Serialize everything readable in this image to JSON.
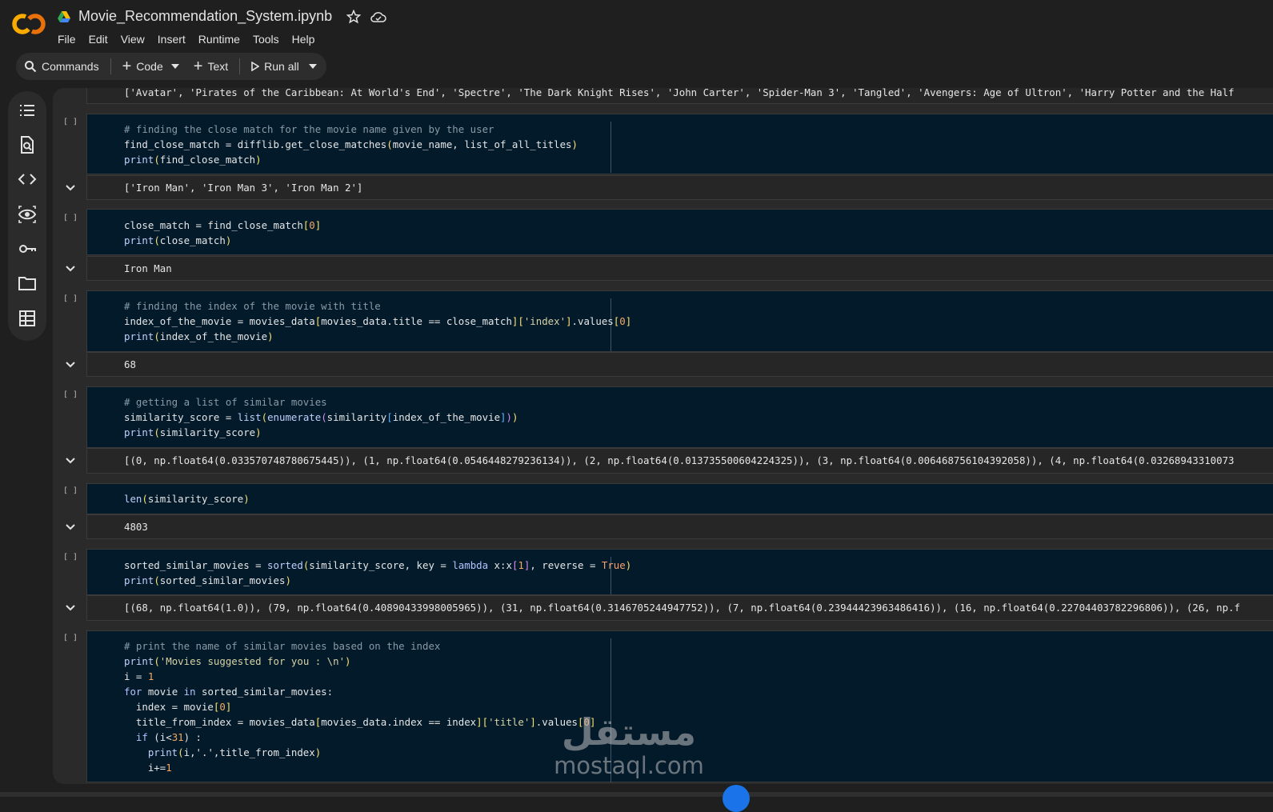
{
  "app": {
    "notebook_title": "Movie_Recommendation_System.ipynb",
    "logo_text": "CO",
    "icons": {
      "drive": "drive-icon",
      "star": "star-icon",
      "cloud": "cloud-saved-icon"
    }
  },
  "menu": [
    "File",
    "Edit",
    "View",
    "Insert",
    "Runtime",
    "Tools",
    "Help"
  ],
  "toolbar": {
    "commands": "Commands",
    "code": "Code",
    "text": "Text",
    "run_all": "Run all"
  },
  "sidebar": [
    "table-of-contents-icon",
    "find-replace-icon",
    "code-snippets-icon",
    "variables-icon",
    "secrets-key-icon",
    "files-folder-icon",
    "data-table-icon"
  ],
  "cells": {
    "prev_output": "['Avatar', 'Pirates of the Caribbean: At World's End', 'Spectre', 'The Dark Knight Rises', 'John Carter', 'Spider-Man 3', 'Tangled', 'Avengers: Age of Ultron', 'Harry Potter and the Half",
    "run_marker": "[ ]",
    "c1": {
      "comment": "# finding the close match for the movie name given by the user",
      "l2a": "find_close_match = difflib.get_close_matches",
      "l2b": "(",
      "l2c": "movie_name, list_of_all_titles",
      "l2d": ")",
      "l3a": "print",
      "l3b": "(",
      "l3c": "find_close_match",
      "l3d": ")",
      "output": "['Iron Man', 'Iron Man 3', 'Iron Man 2']"
    },
    "c2": {
      "l1a": "close_match = find_close_match",
      "l1b": "[",
      "l1c": "0",
      "l1d": "]",
      "l2a": "print",
      "l2b": "(",
      "l2c": "close_match",
      "l2d": ")",
      "output": "Iron Man"
    },
    "c3": {
      "comment": "# finding the index of the movie with title",
      "l2a": "index_of_the_movie = movies_data",
      "l2b": "[",
      "l2c": "movies_data.title == close_match",
      "l2d": "]",
      "l2e": "[",
      "l2f": "'index'",
      "l2g": "]",
      "l2h": ".values",
      "l2i": "[",
      "l2j": "0",
      "l2k": "]",
      "l3a": "print",
      "l3b": "(",
      "l3c": "index_of_the_movie",
      "l3d": ")",
      "output": "68"
    },
    "c4": {
      "comment": "# getting a list of similar movies",
      "l2a": "similarity_score = ",
      "l2b": "list",
      "l2c": "(",
      "l2d": "enumerate",
      "l2e": "(",
      "l2f": "similarity",
      "l2g": "[",
      "l2h": "index_of_the_movie",
      "l2i": "]",
      "l2j": ")",
      "l2k": ")",
      "l3a": "print",
      "l3b": "(",
      "l3c": "similarity_score",
      "l3d": ")",
      "output": "[(0, np.float64(0.033570748780675445)), (1, np.float64(0.0546448279236134)), (2, np.float64(0.013735500604224325)), (3, np.float64(0.006468756104392058)), (4, np.float64(0.03268943310073"
    },
    "c5": {
      "l1a": "len",
      "l1b": "(",
      "l1c": "similarity_score",
      "l1d": ")",
      "output": "4803"
    },
    "c6": {
      "l1a": "sorted_similar_movies = ",
      "l1b": "sorted",
      "l1c": "(",
      "l1d": "similarity_score, key = ",
      "l1e": "lambda",
      "l1f": " x:x",
      "l1g": "[",
      "l1h": "1",
      "l1i": "]",
      "l1j": ", reverse = ",
      "l1k": "True",
      "l1l": ")",
      "l2a": "print",
      "l2b": "(",
      "l2c": "sorted_similar_movies",
      "l2d": ")",
      "output": "[(68, np.float64(1.0)), (79, np.float64(0.40890433998005965)), (31, np.float64(0.3146705244947752)), (7, np.float64(0.23944423963486416)), (16, np.float64(0.22704403782296806)), (26, np.f"
    },
    "c7": {
      "comment": "# print the name of similar movies based on the index",
      "l2a": "print",
      "l2b": "(",
      "l2c": "'Movies suggested for you : \\n'",
      "l2d": ")",
      "l3a": "i = ",
      "l3b": "1",
      "l4a": "for",
      "l4b": " movie ",
      "l4c": "in",
      "l4d": " sorted_similar_movies:",
      "l5a": "  index = movie",
      "l5b": "[",
      "l5c": "0",
      "l5d": "]",
      "l6a": "  title_from_index = movies_data",
      "l6b": "[",
      "l6c": "movies_data.index == index",
      "l6d": "]",
      "l6e": "[",
      "l6f": "'title'",
      "l6g": "]",
      "l6h": ".values",
      "l6i": "[",
      "l6j": "0",
      "l6k": "]",
      "l7a": "  if",
      "l7b": " (i<",
      "l7c": "31",
      "l7d": ") :",
      "l8a": "    print",
      "l8b": "(",
      "l8c": "i,'.',title_from_index",
      "l8d": ")",
      "l9a": "    i+=",
      "l9b": "1"
    }
  },
  "watermark": {
    "arabic": "مستقل",
    "latin": "mostaql.com"
  },
  "colors": {
    "code_bg": "#031a2b",
    "output_bg": "#262626",
    "accent": "#1a73e8",
    "logo_orange": "#f9ab00"
  }
}
